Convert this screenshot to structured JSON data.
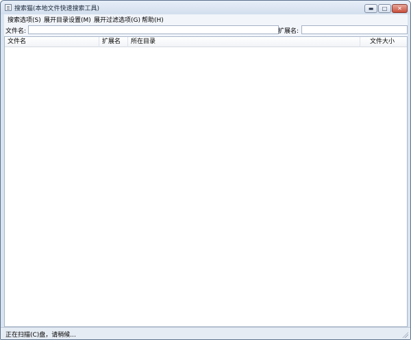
{
  "window": {
    "title": "搜索猫(本地文件快速搜索工具)",
    "minimize_glyph": "▬",
    "maximize_glyph": "□",
    "close_glyph": "✕",
    "icon": "app-window-icon"
  },
  "menu": {
    "items": [
      {
        "label": "搜索选项(S)"
      },
      {
        "label": "展开目录设置(M)"
      },
      {
        "label": "展开过滤选项(G)"
      },
      {
        "label": "帮助(H)"
      }
    ]
  },
  "search": {
    "filename_label": "文件名:",
    "filename_value": "",
    "extension_label": "扩展名:",
    "extension_value": ""
  },
  "table": {
    "columns": [
      "文件名",
      "扩展名",
      "所在目录",
      "文件大小"
    ],
    "rows": []
  },
  "status": {
    "text": "正在扫描(C)盘，请稍候..."
  },
  "colors": {
    "frame": "#d9e4f1",
    "close_button": "#c94f3c",
    "list_background": "#ffffff"
  }
}
